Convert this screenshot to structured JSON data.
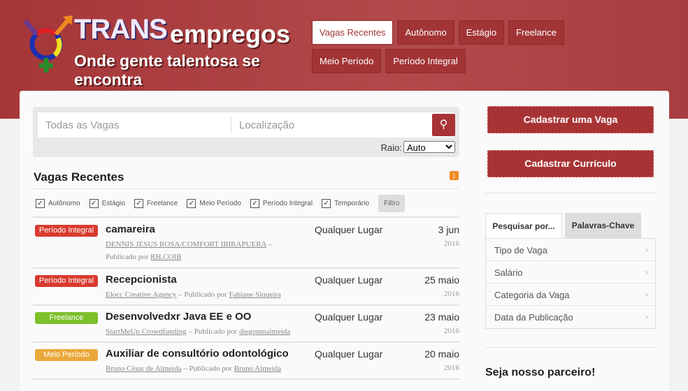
{
  "brand": {
    "name_a": "TRANS",
    "name_b": "empregos",
    "tagline": "Onde gente talentosa se encontra"
  },
  "nav": [
    "Vagas Recentes",
    "Autônomo",
    "Estágio",
    "Freelance",
    "Meio Período",
    "Período Integral"
  ],
  "search": {
    "keywords_placeholder": "Todas as Vagas",
    "location_placeholder": "Localização",
    "radius_label": "Raio:",
    "radius_value": "Auto"
  },
  "section_title": "Vagas Recentes",
  "filters": [
    "Autônomo",
    "Estágio",
    "Freelance",
    "Meio Período",
    "Período Integral",
    "Temporário"
  ],
  "filter_button": "Filtro",
  "jobs": [
    {
      "type": "Período Integral",
      "color": "#d93a2f",
      "title": "camareira",
      "company": "DENNIS JESUS ROSA/COMFORT IBIRAPUERA",
      "sep": " – ",
      "posted_by_label": "Publicado por ",
      "poster": "RH.COIB",
      "location": "Qualquer Lugar",
      "date": "3 jun",
      "year": "2016"
    },
    {
      "type": "Período Integral",
      "color": "#d93a2f",
      "title": "Recepcionista",
      "company": "Elocc Creative Agency",
      "sep": " – ",
      "posted_by_label": "Publicado por ",
      "poster": "Fabiane Siqueira",
      "location": "Qualquer Lugar",
      "date": "25 maio",
      "year": "2016"
    },
    {
      "type": "Freelance",
      "color": "#7cc02a",
      "title": "Desenvolvedxr Java EE e OO",
      "company": "StartMeUp Crowdfunding",
      "sep": " – ",
      "posted_by_label": "Publicado por ",
      "poster": "diegopmalmeida",
      "location": "Qualquer Lugar",
      "date": "23 maio",
      "year": "2016"
    },
    {
      "type": "Meio Período",
      "color": "#eba83a",
      "title": "Auxiliar de consultório odontológico",
      "company": "Bruno César de Almeida",
      "sep": " – ",
      "posted_by_label": "Publicado por ",
      "poster": "Bruno Almeida",
      "location": "Qualquer Lugar",
      "date": "20 maio",
      "year": "2016"
    }
  ],
  "sidebar": {
    "post_job": "Cadastrar uma Vaga",
    "post_resume": "Cadastrar Currículo",
    "tabs": [
      "Pesquisar por...",
      "Palavras-Chave"
    ],
    "facets": [
      "Tipo de Vaga",
      "Salário",
      "Categoria da Vaga",
      "Data da Publicação"
    ],
    "partner_title": "Seja nosso parceiro!"
  },
  "colors": {
    "brand": "#a83335"
  }
}
